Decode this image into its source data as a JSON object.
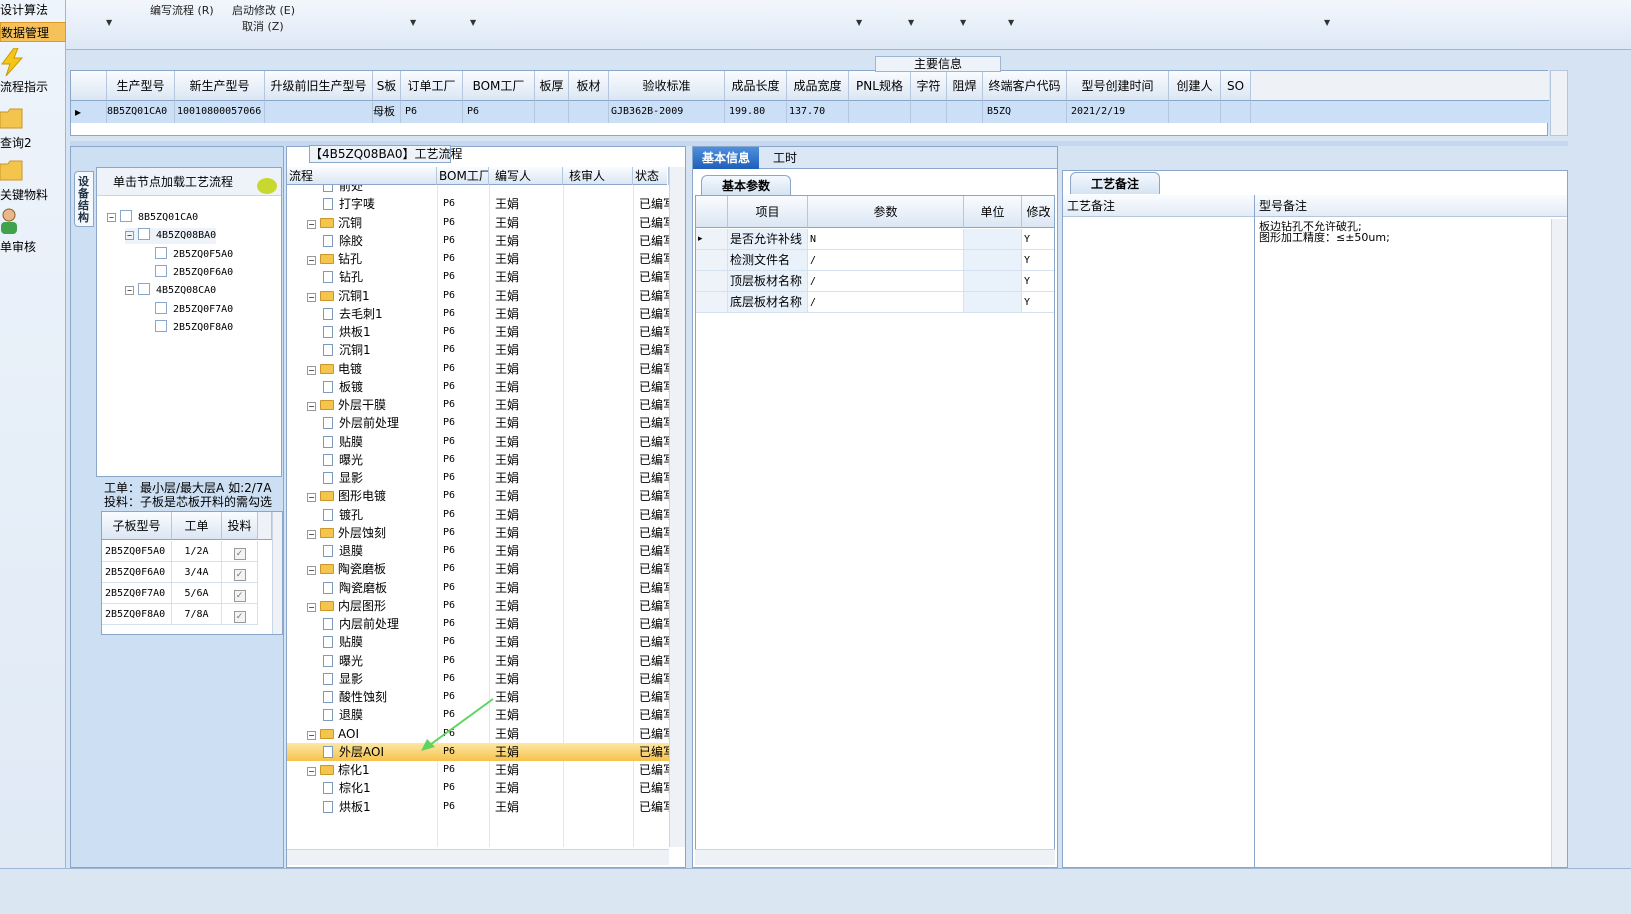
{
  "nav": {
    "top_item": "设计算法",
    "selected_item": "数据管理",
    "buttons": [
      {
        "label": "流程指示",
        "icon": "lightning-icon"
      },
      {
        "label": "查询2",
        "icon": "folder-icon"
      },
      {
        "label": "关键物料",
        "icon": "folder-icon"
      },
      {
        "label": "单审核",
        "icon": "user-icon"
      }
    ]
  },
  "ribbon": {
    "write_flow": "编写流程 (R)",
    "start_modify": "启动修改 (E)",
    "cancel": "取消 (Z)"
  },
  "main_info": {
    "caption": "主要信息",
    "columns": [
      "生产型号",
      "新生产型号",
      "升级前旧生产型号",
      "S板",
      "订单工厂",
      "BOM工厂",
      "板厚",
      "板材",
      "验收标准",
      "成品长度",
      "成品宽度",
      "PNL规格",
      "字符",
      "阻焊",
      "终端客户代码",
      "型号创建时间",
      "创建人",
      "SO"
    ],
    "row": [
      "8B5ZQ01CA0",
      "10010800057066",
      "",
      "母板",
      "P6",
      "P6",
      "",
      "",
      "GJB362B-2009",
      "199.80",
      "137.70",
      "",
      "",
      "",
      "B5ZQ",
      "2021/2/19",
      "",
      ""
    ]
  },
  "left_panel": {
    "vtab": "设备结构",
    "hint": "单击节点加载工艺流程",
    "tree": [
      {
        "label": "8B5ZQ01CA0",
        "level": 0
      },
      {
        "label": "4B5ZQ08BA0",
        "level": 1
      },
      {
        "label": "2B5ZQ0F5A0",
        "level": 2
      },
      {
        "label": "2B5ZQ0F6A0",
        "level": 2
      },
      {
        "label": "4B5ZQ08CA0",
        "level": 1
      },
      {
        "label": "2B5ZQ0F7A0",
        "level": 2
      },
      {
        "label": "2B5ZQ0F8A0",
        "level": 2
      }
    ],
    "info_line1": "工单：最小层/最大层A 如:2/7A",
    "info_line2": "投料：子板是芯板开料的需勾选",
    "sub_columns": [
      "子板型号",
      "工单",
      "投料"
    ],
    "sub_rows": [
      {
        "model": "2B5ZQ0F5A0",
        "order": "1/2A",
        "feed": "✓"
      },
      {
        "model": "2B5ZQ0F6A0",
        "order": "3/4A",
        "feed": "✓"
      },
      {
        "model": "2B5ZQ0F7A0",
        "order": "5/6A",
        "feed": "✓"
      },
      {
        "model": "2B5ZQ0F8A0",
        "order": "7/8A",
        "feed": "✓"
      }
    ]
  },
  "process": {
    "caption": "【4B5ZQ08BA0】工艺流程",
    "columns": [
      "流程",
      "BOM工厂",
      "编写人",
      "核审人",
      "状态"
    ],
    "rows": [
      {
        "name": "前处",
        "type": "doc",
        "bom": "",
        "writer": "",
        "status": ""
      },
      {
        "name": "打字唛",
        "type": "doc",
        "bom": "P6",
        "writer": "王娟",
        "status": "已编写"
      },
      {
        "name": "沉铜",
        "type": "folder",
        "bom": "P6",
        "writer": "王娟",
        "status": "已编写"
      },
      {
        "name": "除胶",
        "type": "doc",
        "bom": "P6",
        "writer": "王娟",
        "status": "已编写"
      },
      {
        "name": "钻孔",
        "type": "folder",
        "bom": "P6",
        "writer": "王娟",
        "status": "已编写"
      },
      {
        "name": "钻孔",
        "type": "doc",
        "bom": "P6",
        "writer": "王娟",
        "status": "已编写"
      },
      {
        "name": "沉铜1",
        "type": "folder",
        "bom": "P6",
        "writer": "王娟",
        "status": "已编写"
      },
      {
        "name": "去毛刺1",
        "type": "doc",
        "bom": "P6",
        "writer": "王娟",
        "status": "已编写"
      },
      {
        "name": "烘板1",
        "type": "doc",
        "bom": "P6",
        "writer": "王娟",
        "status": "已编写"
      },
      {
        "name": "沉铜1",
        "type": "doc",
        "bom": "P6",
        "writer": "王娟",
        "status": "已编写"
      },
      {
        "name": "电镀",
        "type": "folder",
        "bom": "P6",
        "writer": "王娟",
        "status": "已编写"
      },
      {
        "name": "板镀",
        "type": "doc",
        "bom": "P6",
        "writer": "王娟",
        "status": "已编写"
      },
      {
        "name": "外层干膜",
        "type": "folder",
        "bom": "P6",
        "writer": "王娟",
        "status": "已编写"
      },
      {
        "name": "外层前处理",
        "type": "doc",
        "bom": "P6",
        "writer": "王娟",
        "status": "已编写"
      },
      {
        "name": "贴膜",
        "type": "doc",
        "bom": "P6",
        "writer": "王娟",
        "status": "已编写"
      },
      {
        "name": "曝光",
        "type": "doc",
        "bom": "P6",
        "writer": "王娟",
        "status": "已编写"
      },
      {
        "name": "显影",
        "type": "doc",
        "bom": "P6",
        "writer": "王娟",
        "status": "已编写"
      },
      {
        "name": "图形电镀",
        "type": "folder",
        "bom": "P6",
        "writer": "王娟",
        "status": "已编写"
      },
      {
        "name": "镀孔",
        "type": "doc",
        "bom": "P6",
        "writer": "王娟",
        "status": "已编写"
      },
      {
        "name": "外层蚀刻",
        "type": "folder",
        "bom": "P6",
        "writer": "王娟",
        "status": "已编写"
      },
      {
        "name": "退膜",
        "type": "doc",
        "bom": "P6",
        "writer": "王娟",
        "status": "已编写"
      },
      {
        "name": "陶瓷磨板",
        "type": "folder",
        "bom": "P6",
        "writer": "王娟",
        "status": "已编写"
      },
      {
        "name": "陶瓷磨板",
        "type": "doc",
        "bom": "P6",
        "writer": "王娟",
        "status": "已编写"
      },
      {
        "name": "内层图形",
        "type": "folder",
        "bom": "P6",
        "writer": "王娟",
        "status": "已编写"
      },
      {
        "name": "内层前处理",
        "type": "doc",
        "bom": "P6",
        "writer": "王娟",
        "status": "已编写"
      },
      {
        "name": "贴膜",
        "type": "doc",
        "bom": "P6",
        "writer": "王娟",
        "status": "已编写"
      },
      {
        "name": "曝光",
        "type": "doc",
        "bom": "P6",
        "writer": "王娟",
        "status": "已编写"
      },
      {
        "name": "显影",
        "type": "doc",
        "bom": "P6",
        "writer": "王娟",
        "status": "已编写"
      },
      {
        "name": "酸性蚀刻",
        "type": "doc",
        "bom": "P6",
        "writer": "王娟",
        "status": "已编写"
      },
      {
        "name": "退膜",
        "type": "doc",
        "bom": "P6",
        "writer": "王娟",
        "status": "已编写"
      },
      {
        "name": "AOI",
        "type": "folder",
        "bom": "P6",
        "writer": "王娟",
        "status": "已编写"
      },
      {
        "name": "外层AOI",
        "type": "doc",
        "bom": "P6",
        "writer": "王娟",
        "status": "已编写",
        "selected": true
      },
      {
        "name": "棕化1",
        "type": "folder",
        "bom": "P6",
        "writer": "王娟",
        "status": "已编写"
      },
      {
        "name": "棕化1",
        "type": "doc",
        "bom": "P6",
        "writer": "王娟",
        "status": "已编写"
      },
      {
        "name": "烘板1",
        "type": "doc",
        "bom": "P6",
        "writer": "王娟",
        "status": "已编写"
      }
    ]
  },
  "basic": {
    "tab_active": "基本信息",
    "tab_other": "工时",
    "section": "基本参数",
    "columns": [
      "项目",
      "参数",
      "单位",
      "修改"
    ],
    "rows": [
      {
        "item": "是否允许补线",
        "param": "N",
        "unit": "",
        "mod": "Y"
      },
      {
        "item": "检测文件名",
        "param": "/",
        "unit": "",
        "mod": "Y"
      },
      {
        "item": "顶层板材名称",
        "param": "/",
        "unit": "",
        "mod": "Y"
      },
      {
        "item": "底层板材名称",
        "param": "/",
        "unit": "",
        "mod": "Y"
      }
    ]
  },
  "notes": {
    "caption": "工艺备注",
    "col1": "工艺备注",
    "col2": "型号备注",
    "line1": "板边钻孔不允许破孔;",
    "line2": "图形加工精度：≤±50um;"
  }
}
